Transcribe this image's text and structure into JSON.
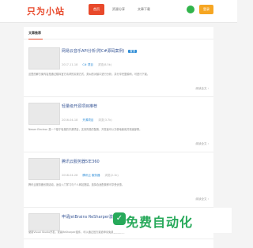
{
  "header": {
    "logo": "只为小站",
    "nav": [
      {
        "label": "首页",
        "active": true
      },
      {
        "label": "资源分享"
      },
      {
        "label": "文章下载",
        "active": false
      }
    ],
    "user_icon": "wechat-icon",
    "right_button": "登录"
  },
  "section": {
    "title": "文章推荐"
  },
  "items": [
    {
      "title": "网易云音乐API分析(附C#源码案例)",
      "tag": "置顶",
      "date": "2017-11-18",
      "category": "C# 项目",
      "views": "浏览(8.5k)",
      "summary": "这里的解方案内容是通过模拟官方请求的实现方式，类似的对接口进行分析，并分享完整源码，可进行下载。",
      "more": "阅读全文 ›"
    },
    {
      "title": "轻量级开源项目推荐",
      "tag": "",
      "date": "2016-04-18",
      "category": "开源项目",
      "views": "浏览(3.7k)",
      "summary": "Newer Electron 是一个基于轻量的开源项目，支持简易的配置，开发者可以方便地使用并快速部署。",
      "more": "阅读全文 ›"
    },
    {
      "title": "腾讯云服务器5年360",
      "tag": "",
      "date": "2018-04-28",
      "category": "腾讯云 服务器",
      "views": "浏览(2.1k)",
      "summary": "腾讯云服务器长期活动，适合入门学习与个人网站搭建，选择合适配置即可享受优惠。",
      "more": "阅读全文 ›"
    },
    {
      "title": "申请JetBrains ReSharper激活码",
      "tag": "",
      "date": "",
      "category": "",
      "views": "",
      "summary": "使用Visual Studio开发，安装ReSharper插件，可以通过官方渠道申请免费授权使用。",
      "more": ""
    }
  ],
  "watermark": {
    "text": "免费自动化"
  }
}
